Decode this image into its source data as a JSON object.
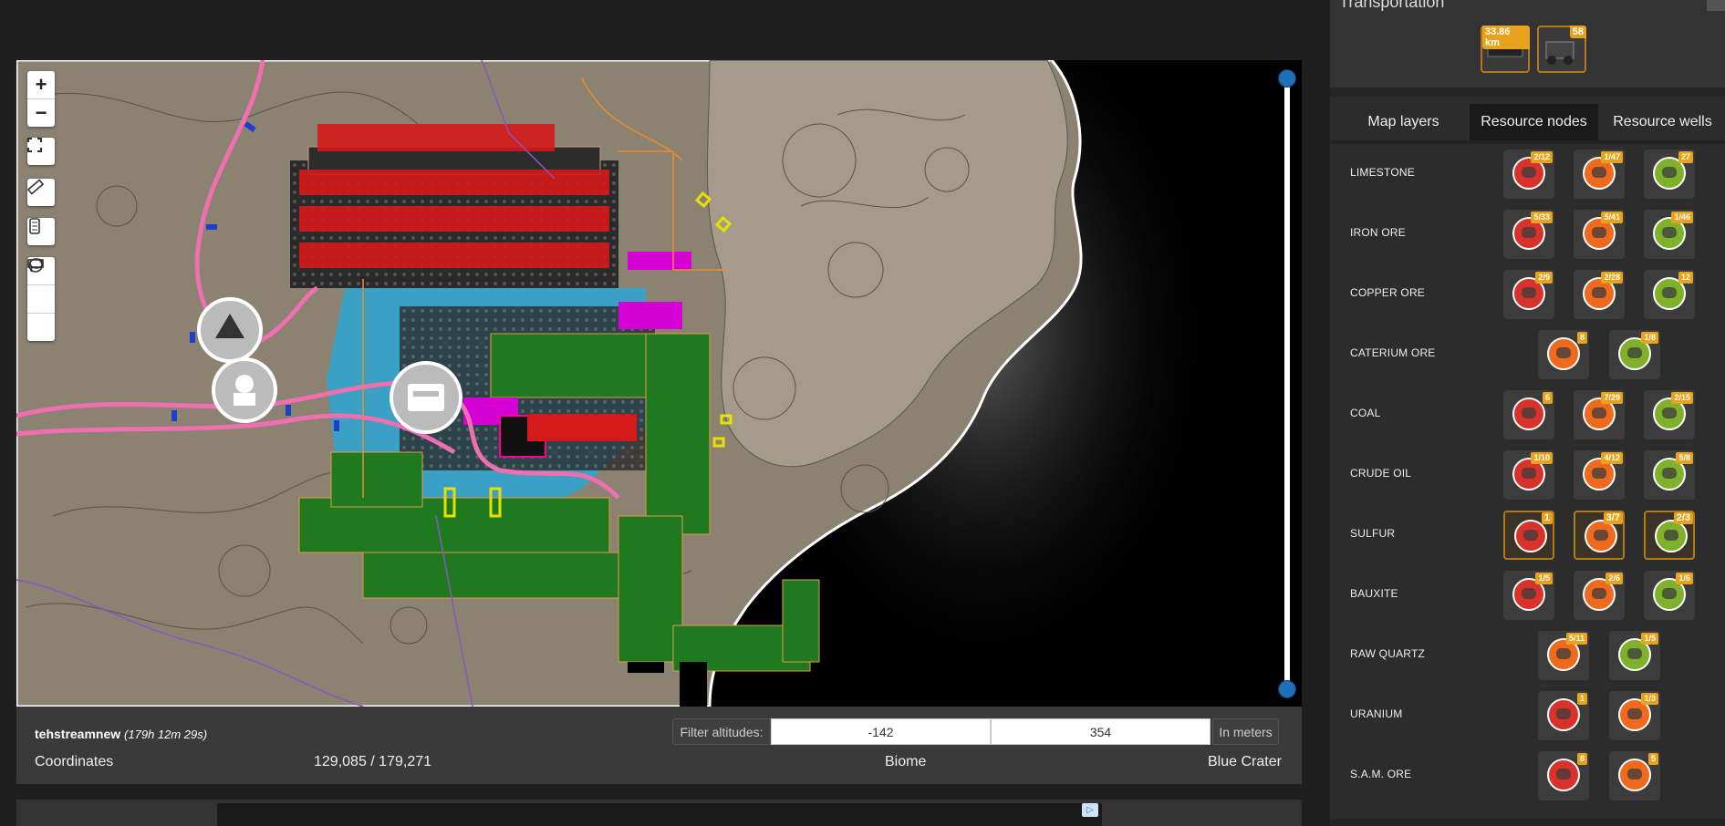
{
  "map_controls": {
    "zoom_in": "+",
    "zoom_out": "−"
  },
  "info": {
    "username": "tehstreamnew",
    "playtime": "(179h 12m 29s)",
    "filter_label": "Filter altitudes:",
    "alt_min": "-142",
    "alt_max": "354",
    "unit_label": "In meters",
    "coords_label": "Coordinates",
    "coords_value": "129,085 / 179,271",
    "biome_label": "Biome",
    "biome_value": "Blue Crater"
  },
  "sidebar": {
    "transport_title": "Transportation",
    "transport_slots": [
      {
        "name": "belt",
        "badge": "33.86 km"
      },
      {
        "name": "vehicle",
        "badge": "58"
      }
    ],
    "tabs": [
      {
        "label": "Map layers",
        "active": false
      },
      {
        "label": "Resource nodes",
        "active": true
      },
      {
        "label": "Resource wells",
        "active": false
      }
    ],
    "resources": [
      {
        "name": "LIMESTONE",
        "nodes": [
          {
            "p": "impure",
            "badge": "2/12"
          },
          {
            "p": "normal",
            "badge": "1/47"
          },
          {
            "p": "pure",
            "badge": "27"
          }
        ]
      },
      {
        "name": "IRON ORE",
        "nodes": [
          {
            "p": "impure",
            "badge": "5/33"
          },
          {
            "p": "normal",
            "badge": "5/41"
          },
          {
            "p": "pure",
            "badge": "1/46"
          }
        ]
      },
      {
        "name": "COPPER ORE",
        "nodes": [
          {
            "p": "impure",
            "badge": "2/9"
          },
          {
            "p": "normal",
            "badge": "2/28"
          },
          {
            "p": "pure",
            "badge": "12"
          }
        ]
      },
      {
        "name": "CATERIUM ORE",
        "nodes": [
          {
            "p": "normal",
            "badge": "8"
          },
          {
            "p": "pure",
            "badge": "1/8"
          }
        ]
      },
      {
        "name": "COAL",
        "nodes": [
          {
            "p": "impure",
            "badge": "6"
          },
          {
            "p": "normal",
            "badge": "7/29"
          },
          {
            "p": "pure",
            "badge": "2/15"
          }
        ]
      },
      {
        "name": "CRUDE OIL",
        "nodes": [
          {
            "p": "impure",
            "badge": "1/10"
          },
          {
            "p": "normal",
            "badge": "4/12"
          },
          {
            "p": "pure",
            "badge": "5/8"
          }
        ]
      },
      {
        "name": "SULFUR",
        "nodes": [
          {
            "p": "impure",
            "badge": "1",
            "sel": true
          },
          {
            "p": "normal",
            "badge": "3/7",
            "sel": true
          },
          {
            "p": "pure",
            "badge": "2/3",
            "sel": true
          }
        ]
      },
      {
        "name": "BAUXITE",
        "nodes": [
          {
            "p": "impure",
            "badge": "1/5"
          },
          {
            "p": "normal",
            "badge": "2/6"
          },
          {
            "p": "pure",
            "badge": "1/6"
          }
        ]
      },
      {
        "name": "RAW QUARTZ",
        "nodes": [
          {
            "p": "normal",
            "badge": "5/11"
          },
          {
            "p": "pure",
            "badge": "1/5"
          }
        ]
      },
      {
        "name": "URANIUM",
        "nodes": [
          {
            "p": "impure",
            "badge": "1"
          },
          {
            "p": "normal",
            "badge": "1/3"
          }
        ]
      },
      {
        "name": "S.A.M. ORE",
        "nodes": [
          {
            "p": "impure",
            "badge": "8"
          },
          {
            "p": "normal",
            "badge": "5"
          }
        ]
      }
    ]
  },
  "colors": {
    "impure": "#d9322b",
    "normal": "#ef6a1c",
    "pure": "#7fb22a",
    "badge": "#e8a21c",
    "accent_knob": "#1e6fb8"
  }
}
